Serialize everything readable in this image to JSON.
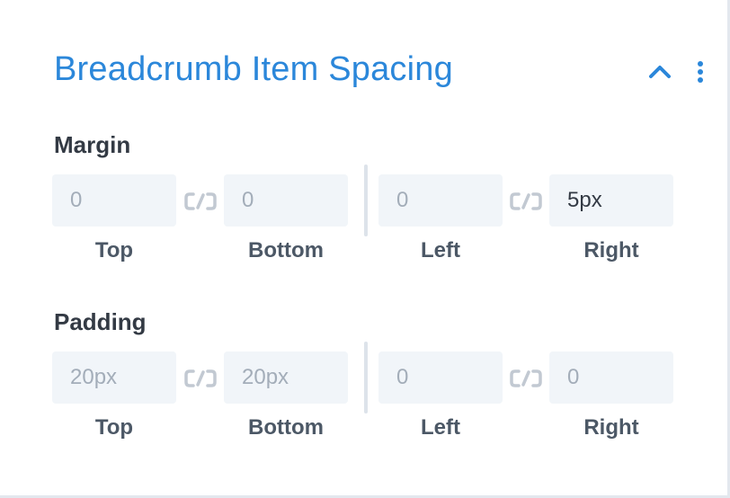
{
  "panel": {
    "title": "Breadcrumb Item Spacing",
    "collapse_icon": "chevron-up-icon",
    "menu_icon": "kebab-menu-icon",
    "accent_color": "#2b87da"
  },
  "margin": {
    "label": "Margin",
    "top": {
      "value": "0",
      "label": "Top"
    },
    "bottom": {
      "value": "0",
      "label": "Bottom"
    },
    "left": {
      "value": "0",
      "label": "Left"
    },
    "right": {
      "value": "5px",
      "label": "Right"
    }
  },
  "padding": {
    "label": "Padding",
    "top": {
      "value": "20px",
      "label": "Top"
    },
    "bottom": {
      "value": "20px",
      "label": "Bottom"
    },
    "left": {
      "value": "0",
      "label": "Left"
    },
    "right": {
      "value": "0",
      "label": "Right"
    }
  }
}
